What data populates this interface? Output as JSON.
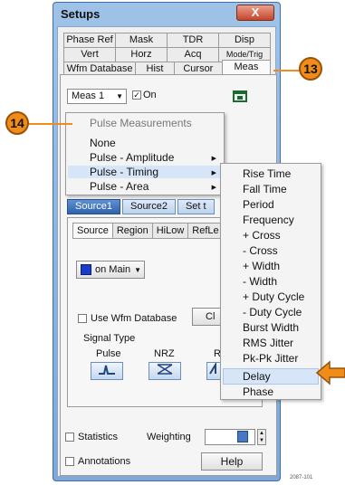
{
  "window": {
    "title": "Setups",
    "close_label": "X"
  },
  "tabs_row1": [
    "Phase Ref",
    "Mask",
    "TDR",
    "Disp"
  ],
  "tabs_row2": [
    "Vert",
    "Horz",
    "Acq",
    "Mode/Trig"
  ],
  "tabs_row3": [
    "Wfm Database",
    "Hist",
    "Cursor",
    "Meas"
  ],
  "meas": {
    "selected": "Meas 1",
    "on_label": "On",
    "on_checked": true
  },
  "menu": {
    "header": "Pulse Measurements",
    "items": [
      "None",
      "Pulse - Amplitude",
      "Pulse - Timing",
      "Pulse - Area"
    ],
    "highlighted": "Pulse - Timing"
  },
  "submenu": {
    "items": [
      "Rise Time",
      "Fall Time",
      "Period",
      "Frequency",
      "+ Cross",
      "- Cross",
      "+ Width",
      "- Width",
      "+ Duty Cycle",
      "- Duty Cycle",
      "Burst Width",
      "RMS Jitter",
      "Pk-Pk Jitter",
      "Delay",
      "Phase"
    ],
    "highlighted": "Delay"
  },
  "source_tabs": [
    "Source1",
    "Source2",
    "Set t"
  ],
  "inner_tabs": [
    "Source",
    "Region",
    "HiLow",
    "RefLe"
  ],
  "source": {
    "value": "on Main",
    "swatch_color": "#1a3cc8"
  },
  "use_wfm_label": "Use Wfm Database",
  "clear_label": "Cl",
  "signal_type": {
    "label": "Signal Type",
    "options": [
      "Pulse",
      "NRZ",
      "R"
    ]
  },
  "statistics_label": "Statistics",
  "weighting_label": "Weighting",
  "annotations_label": "Annotations",
  "help_label": "Help",
  "callouts": {
    "a": "13",
    "b": "14"
  },
  "figure_id": "2087-101",
  "colors": {
    "callout": "#f08c1a",
    "accent": "#2e62ad",
    "highlight": "#d6e6f8"
  }
}
